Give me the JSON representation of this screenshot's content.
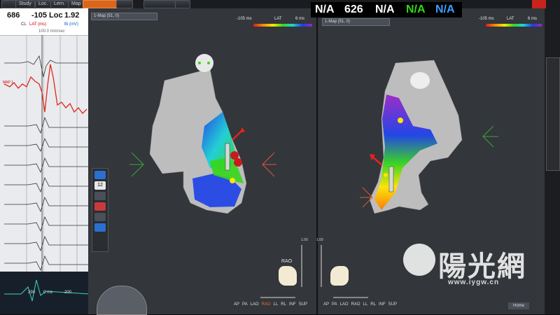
{
  "menu": [
    "",
    "Study",
    "Loc.",
    "Lern.",
    "Map",
    "",
    "",
    "",
    ""
  ],
  "readouts": {
    "cl": "686",
    "cl_lbl": "CL",
    "lat": "-105",
    "lat_lbl": "LAT (ms)",
    "loc": "Loc",
    "bi": "1.92",
    "bi_lbl": "Bi (mV)",
    "sweep": "100.0 mm/sec"
  },
  "channels": [
    "MAP 1",
    "",
    "",
    "",
    "",
    "",
    "",
    "",
    ""
  ],
  "ecg_time": [
    "290",
    "0 ms",
    "200"
  ],
  "maps": {
    "left_tab": "1-Map (51, 0)",
    "right_tab": "1-Map (51, 0)",
    "lat_min": "-105 ms",
    "lat_label": "LAT",
    "lat_max": "6 ms"
  },
  "top_readout": {
    "values": [
      "N/A",
      "626",
      "N/A",
      "N/A",
      "N/A"
    ],
    "colors": [
      "#ffffff",
      "#ffffff",
      "#ffffff",
      "#35d61b",
      "#3aa0ff"
    ]
  },
  "view": {
    "label": "RAO",
    "zoom": "1.00",
    "views": [
      "AP",
      "PA",
      "LAO",
      "RAO",
      "LL",
      "RL",
      "INF",
      "SUP"
    ],
    "active_view": "RAO"
  },
  "watermark": {
    "text": "陽光網",
    "url": "www.iygw.cn"
  },
  "right_panel": {
    "home": "Home"
  },
  "colors": {
    "accent": "#d9661f",
    "panel": "#33363b",
    "chamber": "#bdbdbd"
  }
}
